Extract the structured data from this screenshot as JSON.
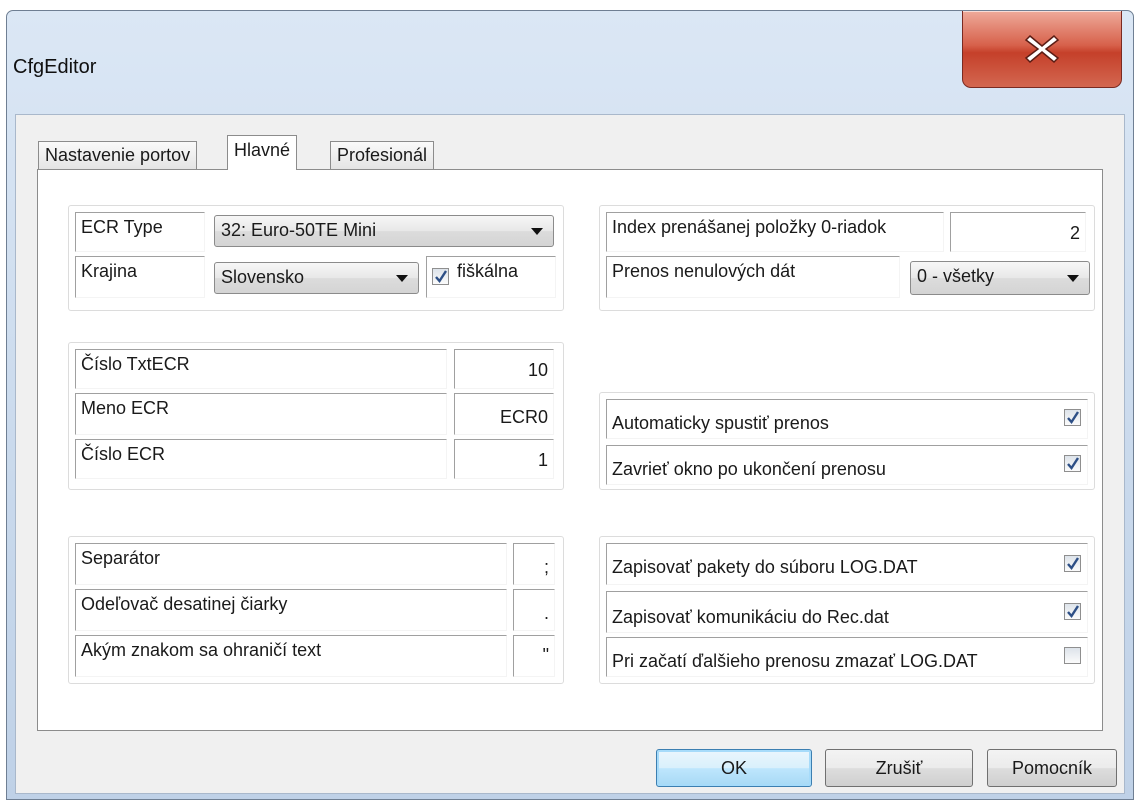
{
  "window": {
    "title": "CfgEditor"
  },
  "tabs": [
    {
      "label": "Nastavenie portov"
    },
    {
      "label": "Hlavné",
      "active": true
    },
    {
      "label": "Profesionál"
    }
  ],
  "ecr": {
    "type_label": "ECR Type",
    "type_value": "32: Euro-50TE Mini",
    "country_label": "Krajina",
    "country_value": "Slovensko",
    "fiscal_label": "fiškálna",
    "fiscal_checked": true
  },
  "transfer": {
    "index_label": "Index prenášanej položky 0-riadok",
    "index_value": "2",
    "nonzero_label": "Prenos nenulových dát",
    "nonzero_value": "0 - všetky"
  },
  "ecr_info": {
    "txt_label": "Číslo TxtECR",
    "txt_value": "10",
    "name_label": "Meno ECR",
    "name_value": "ECR0",
    "num_label": "Číslo ECR",
    "num_value": "1"
  },
  "auto": {
    "start_label": "Automaticky spustiť prenos",
    "start_checked": true,
    "close_label": "Zavrieť okno po ukončení prenosu",
    "close_checked": true
  },
  "format": {
    "separator_label": "Separátor",
    "separator_value": ";",
    "decimal_label": "Odeľovač desatinej čiarky",
    "decimal_value": ".",
    "quote_label": "Akým znakom sa ohraničí text",
    "quote_value": "\""
  },
  "logging": {
    "log_label": "Zapisovať pakety do súboru LOG.DAT",
    "log_checked": true,
    "rec_label": "Zapisovať komunikáciu do Rec.dat",
    "rec_checked": true,
    "clear_label": "Pri začatí ďalšieho prenosu zmazať LOG.DAT",
    "clear_checked": false
  },
  "buttons": {
    "ok": "OK",
    "cancel": "Zrušiť",
    "help": "Pomocník"
  },
  "colors": {
    "close_button": "#c94a34",
    "default_button": "#bee6fd",
    "tab_page": "#ffffff"
  }
}
